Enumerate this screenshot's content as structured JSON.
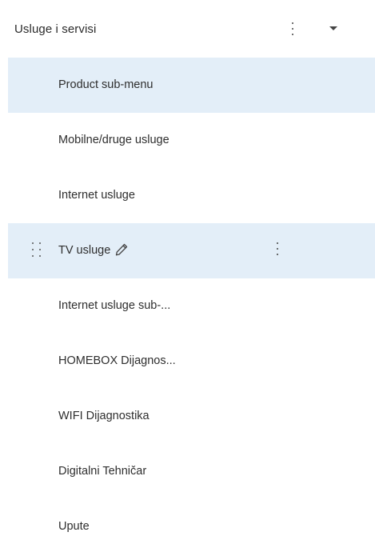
{
  "header": {
    "title": "Usluge i servisi",
    "menu_icon": "more-vertical-icon",
    "collapse_icon": "caret-down-icon"
  },
  "menu": {
    "items": [
      {
        "label": "Product sub-menu",
        "state": "selected"
      },
      {
        "label": "Mobilne/druge usluge",
        "state": "default"
      },
      {
        "label": "Internet usluge",
        "state": "default"
      },
      {
        "label": "TV usluge",
        "state": "hovered",
        "icons": [
          "drag-handle-icon",
          "pencil-icon",
          "more-vertical-icon"
        ]
      },
      {
        "label": "Internet usluge sub-...",
        "state": "default"
      },
      {
        "label": "HOMEBOX Dijagnos...",
        "state": "default"
      },
      {
        "label": "WIFI Dijagnostika",
        "state": "default"
      },
      {
        "label": "Digitalni Tehničar",
        "state": "default"
      },
      {
        "label": "Upute",
        "state": "default"
      }
    ]
  },
  "colors": {
    "highlight": "#e3eef8",
    "text": "#2e2e2e",
    "icon": "#444444"
  }
}
